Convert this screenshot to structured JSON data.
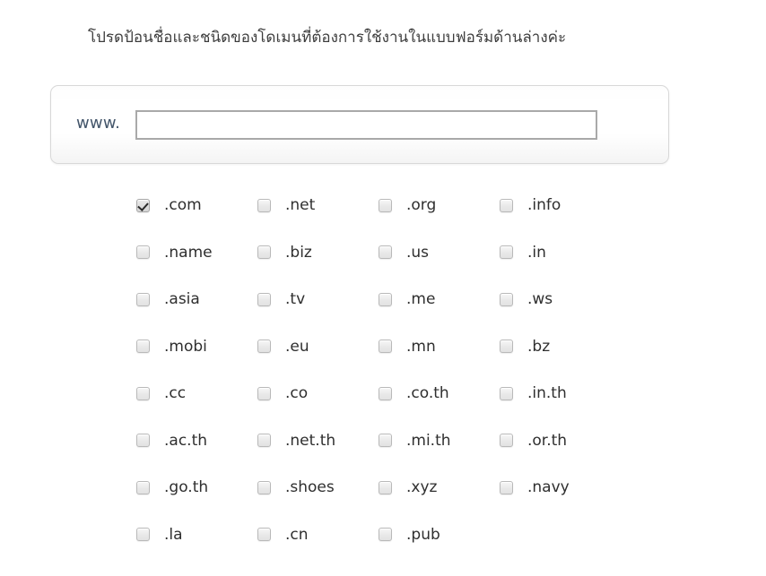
{
  "heading": {
    "text": "โปรดป้อนชื่อและชนิดของโดเมนที่ต้องการใช้งานในแบบฟอร์มด้านล่างค่ะ"
  },
  "domain_panel": {
    "prefix_label": "www.",
    "input": {
      "value": "",
      "placeholder": ""
    }
  },
  "tld_grid": {
    "columns": 4,
    "rows": [
      [
        {
          "label": ".com",
          "checked": true
        },
        {
          "label": ".net",
          "checked": false
        },
        {
          "label": ".org",
          "checked": false
        },
        {
          "label": ".info",
          "checked": false
        }
      ],
      [
        {
          "label": ".name",
          "checked": false
        },
        {
          "label": ".biz",
          "checked": false
        },
        {
          "label": ".us",
          "checked": false
        },
        {
          "label": ".in",
          "checked": false
        }
      ],
      [
        {
          "label": ".asia",
          "checked": false
        },
        {
          "label": ".tv",
          "checked": false
        },
        {
          "label": ".me",
          "checked": false
        },
        {
          "label": ".ws",
          "checked": false
        }
      ],
      [
        {
          "label": ".mobi",
          "checked": false
        },
        {
          "label": ".eu",
          "checked": false
        },
        {
          "label": ".mn",
          "checked": false
        },
        {
          "label": ".bz",
          "checked": false
        }
      ],
      [
        {
          "label": ".cc",
          "checked": false
        },
        {
          "label": ".co",
          "checked": false
        },
        {
          "label": ".co.th",
          "checked": false
        },
        {
          "label": ".in.th",
          "checked": false
        }
      ],
      [
        {
          "label": ".ac.th",
          "checked": false
        },
        {
          "label": ".net.th",
          "checked": false
        },
        {
          "label": ".mi.th",
          "checked": false
        },
        {
          "label": ".or.th",
          "checked": false
        }
      ],
      [
        {
          "label": ".go.th",
          "checked": false
        },
        {
          "label": ".shoes",
          "checked": false
        },
        {
          "label": ".xyz",
          "checked": false
        },
        {
          "label": ".navy",
          "checked": false
        }
      ],
      [
        {
          "label": ".la",
          "checked": false
        },
        {
          "label": ".cn",
          "checked": false
        },
        {
          "label": ".pub",
          "checked": false
        }
      ]
    ]
  },
  "colors": {
    "page_background": "#ffffff",
    "heading_text": "#3d3d3d",
    "label_text": "#2f2f2f",
    "prefix_text": "#44566b",
    "panel_border": "#d8d8d8",
    "input_border": "#a9a9a9",
    "checkbox_border": "#b9b9b9",
    "checkmark": "#2b2b2b"
  }
}
